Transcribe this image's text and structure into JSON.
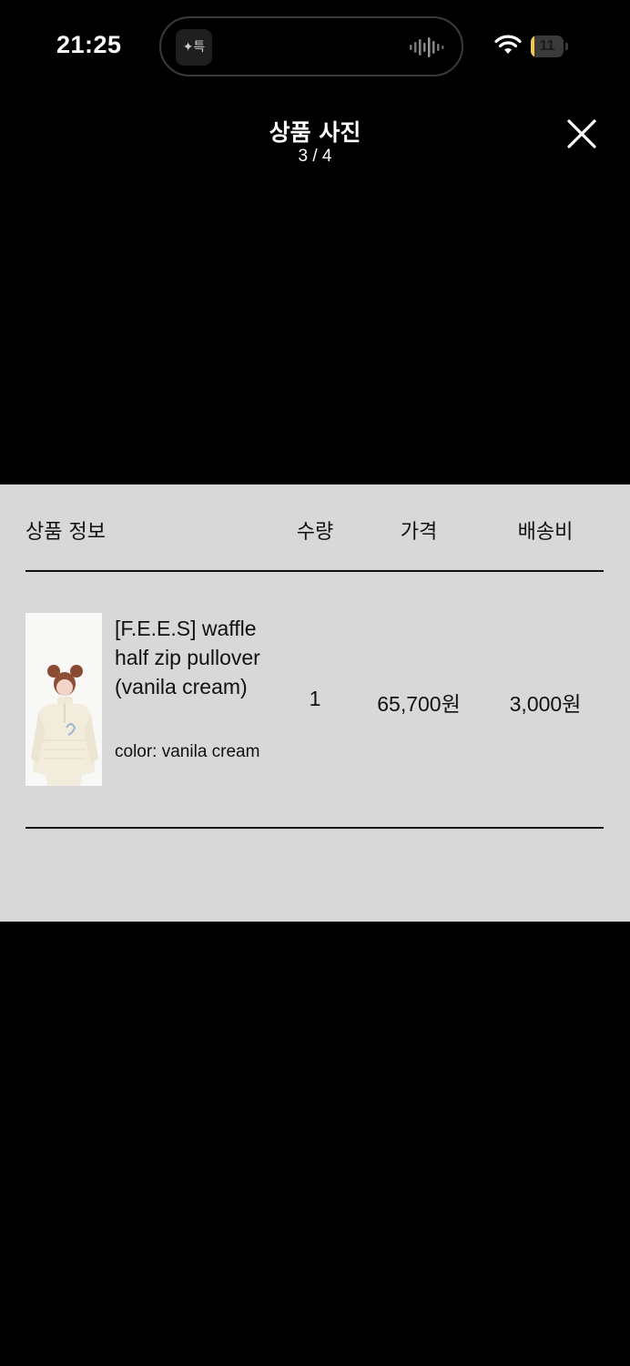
{
  "status_bar": {
    "time": "21:25",
    "battery_level": "11",
    "battery_fraction": 0.11,
    "island_app_icon": "app-logo-icon",
    "wifi_icon": "wifi-icon",
    "battery_color": "#f2c94c"
  },
  "header": {
    "title": "상품 사진",
    "counter": "3 / 4",
    "close_icon": "close-icon"
  },
  "table": {
    "headers": {
      "product": "상품 정보",
      "quantity": "수량",
      "price": "가격",
      "shipping": "배송비"
    },
    "row": {
      "name": "[F.E.E.S] waffle half zip pullover (vanila cream)",
      "option": "color: vanila cream",
      "quantity": "1",
      "price": "65,700원",
      "shipping": "3,000원"
    }
  },
  "colors": {
    "background": "#000000",
    "panel": "#d8d8d8",
    "text_dark": "#111111"
  }
}
